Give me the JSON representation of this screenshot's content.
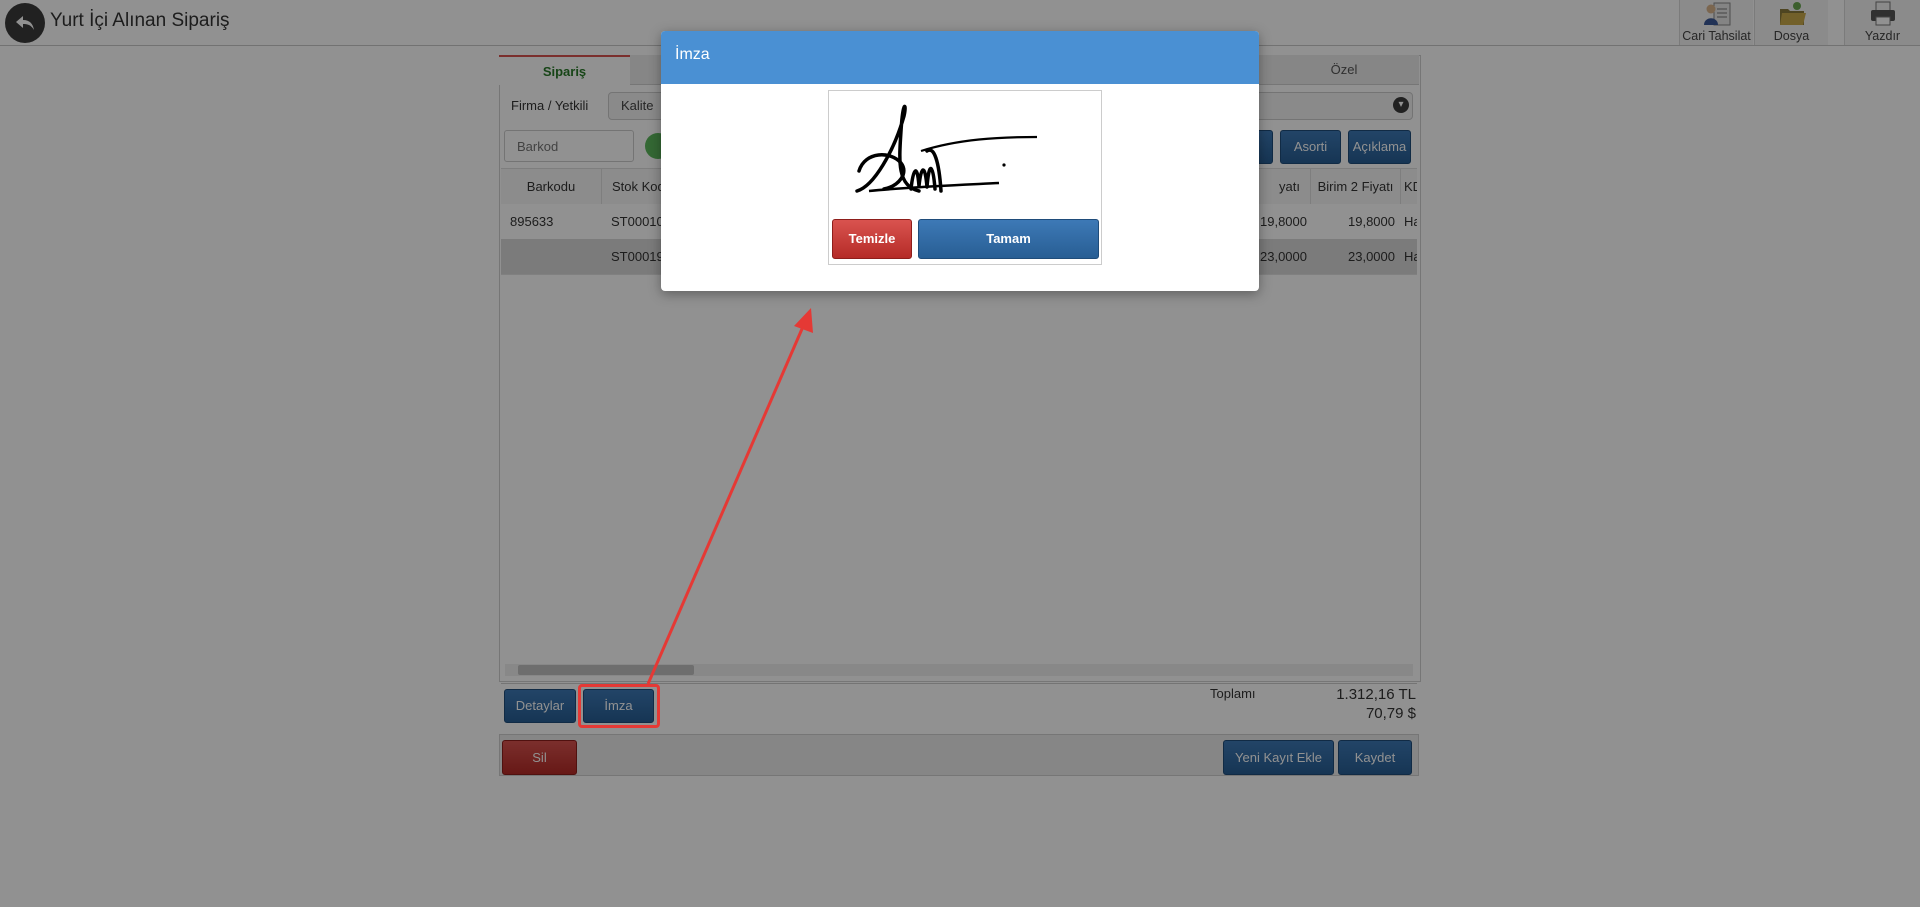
{
  "header": {
    "title": "Yurt İçi Alınan Sipariş",
    "buttons": [
      {
        "label": "Cari Tahsilat",
        "icon": "person-card-icon"
      },
      {
        "label": "Dosya",
        "icon": "folder-icon"
      },
      {
        "label": "Yazdır",
        "icon": "printer-icon"
      }
    ]
  },
  "tabs": {
    "active": "Sipariş",
    "last": "Özel"
  },
  "form": {
    "firma_label": "Firma / Yetkili",
    "firma_value": "Kalite",
    "barkod_placeholder": "Barkod",
    "buttons": {
      "hidden": "",
      "asorti": "Asorti",
      "aciklama": "Açıklama"
    }
  },
  "grid": {
    "headers": {
      "barkodu": "Barkodu",
      "stok_kodu": "Stok Kod",
      "fiyati": "yatı",
      "birim2": "Birim 2 Fiyatı",
      "kdv": "KD"
    },
    "rows": [
      {
        "barkodu": "895633",
        "stok_kodu": "ST00010",
        "fiyati": "19,8000",
        "birim2": "19,8000",
        "kdv": "Ha"
      },
      {
        "barkodu": "",
        "stok_kodu": "ST00019",
        "fiyati": "23,0000",
        "birim2": "23,0000",
        "kdv": "Ha"
      }
    ]
  },
  "footer": {
    "detaylar": "Detaylar",
    "imza": "İmza",
    "toplam_label": "Toplamı",
    "toplam_tl": "1.312,16 TL",
    "toplam_usd": "70,79 $"
  },
  "actions": {
    "sil": "Sil",
    "yeni": "Yeni Kayıt Ekle",
    "kaydet": "Kaydet"
  },
  "modal": {
    "title": "İmza",
    "temizle": "Temizle",
    "tamam": "Tamam"
  },
  "colors": {
    "primary": "#4a90d3",
    "danger": "#d9534f",
    "annotation": "#e53935"
  }
}
